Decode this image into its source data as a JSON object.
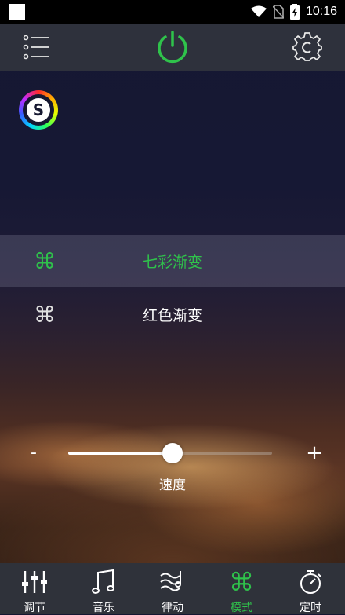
{
  "status_bar": {
    "time": "10:16"
  },
  "colors": {
    "accent": "#2fc24b",
    "topbar": "#2e313c",
    "bottomnav": "#2f323a"
  },
  "top_bar": {
    "menu_icon": "list-menu-icon",
    "power_icon": "power-icon",
    "settings_icon": "settings-gear-icon"
  },
  "logo": {
    "letter": "S"
  },
  "modes": [
    {
      "label": "七彩渐变",
      "icon": "command-icon",
      "selected": true
    },
    {
      "label": "红色渐变",
      "icon": "command-icon",
      "selected": false
    }
  ],
  "speed": {
    "label": "速度",
    "minus": "-",
    "plus": "+",
    "value": 0.51
  },
  "bottom_nav": [
    {
      "label": "调节",
      "icon": "sliders-icon"
    },
    {
      "label": "音乐",
      "icon": "music-note-icon"
    },
    {
      "label": "律动",
      "icon": "rhythm-wave-icon"
    },
    {
      "label": "模式",
      "icon": "command-icon",
      "active": true
    },
    {
      "label": "定时",
      "icon": "stopwatch-icon"
    }
  ]
}
